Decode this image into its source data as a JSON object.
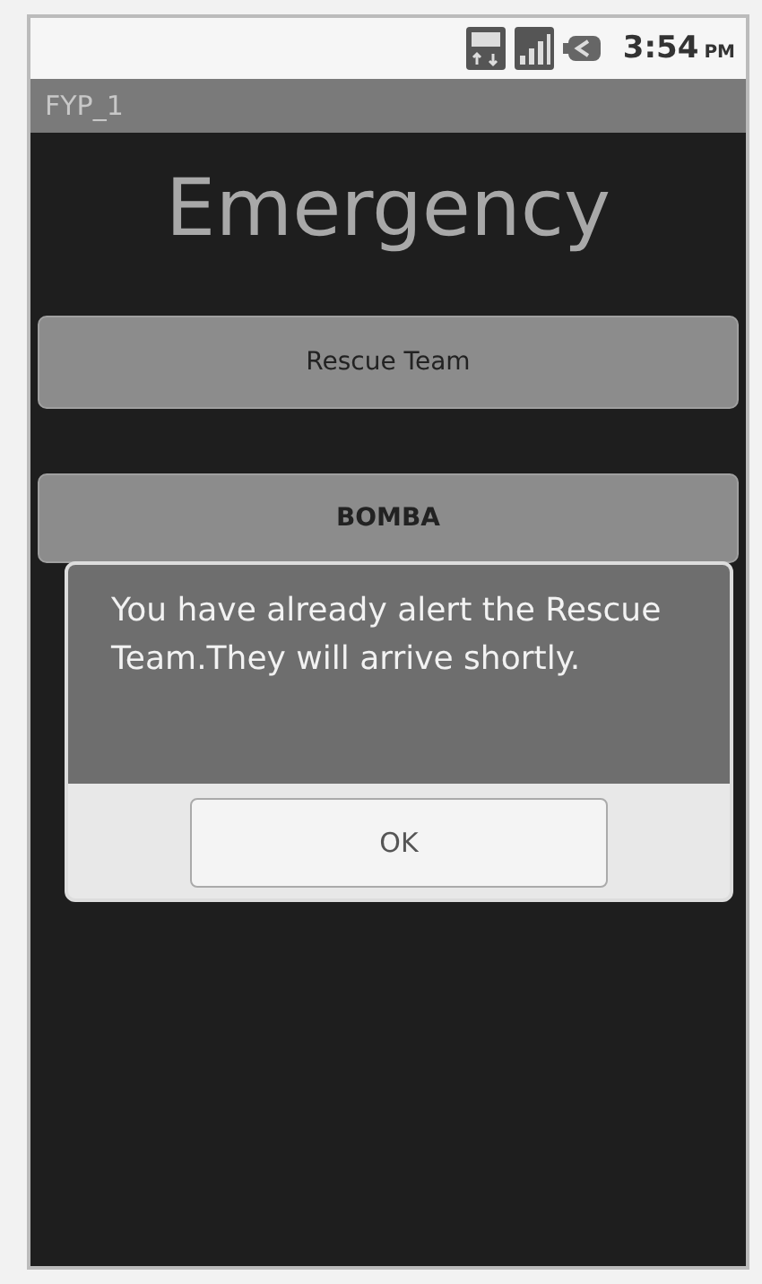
{
  "status_bar": {
    "time": "3:54",
    "time_suffix": "PM"
  },
  "app_bar": {
    "title": "FYP_1"
  },
  "heading": "Emergency",
  "buttons": [
    {
      "label": "Rescue Team",
      "bold": false
    },
    {
      "label": "BOMBA",
      "bold": true
    }
  ],
  "dialog": {
    "message": "You have already alert the Rescue Team.They will arrive shortly.",
    "button": "OK"
  }
}
